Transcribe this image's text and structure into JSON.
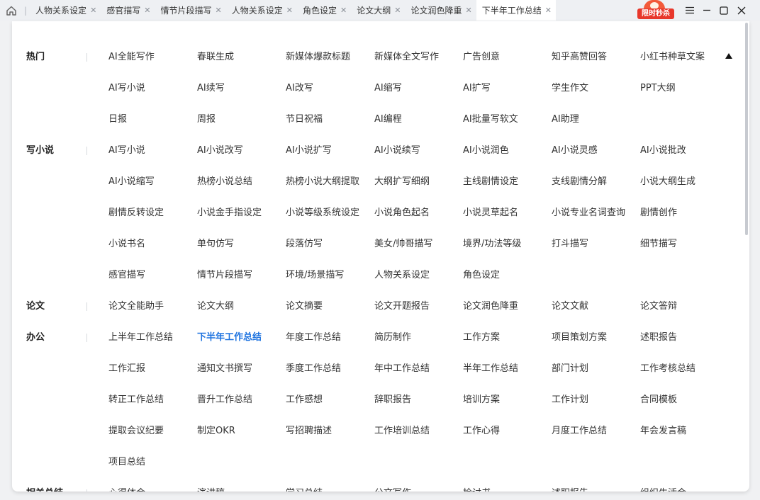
{
  "tabs": [
    {
      "label": "人物关系设定",
      "active": false
    },
    {
      "label": "感官描写",
      "active": false
    },
    {
      "label": "情节片段描写",
      "active": false
    },
    {
      "label": "人物关系设定",
      "active": false
    },
    {
      "label": "角色设定",
      "active": false
    },
    {
      "label": "论文大纲",
      "active": false
    },
    {
      "label": "论文润色降重",
      "active": false
    },
    {
      "label": "下半年工作总结",
      "active": true
    }
  ],
  "promo_label": "限时秒杀",
  "window_controls": [
    "menu-icon",
    "minimize-icon",
    "maximize-icon",
    "close-icon"
  ],
  "accent_color": "#1f74e0",
  "sections": [
    {
      "title": "热门",
      "rows": [
        [
          "AI全能写作",
          "春联生成",
          "新媒体爆款标题",
          "新媒体全文写作",
          "广告创意",
          "知乎高赞回答",
          "小红书种草文案"
        ],
        [
          "AI写小说",
          "AI续写",
          "AI改写",
          "AI缩写",
          "AI扩写",
          "学生作文",
          "PPT大纲"
        ],
        [
          "日报",
          "周报",
          "节日祝福",
          "AI编程",
          "AI批量写软文",
          "AI助理"
        ]
      ]
    },
    {
      "title": "写小说",
      "rows": [
        [
          "AI写小说",
          "AI小说改写",
          "AI小说扩写",
          "AI小说续写",
          "AI小说润色",
          "AI小说灵感",
          "AI小说批改"
        ],
        [
          "AI小说缩写",
          "热榜小说总结",
          "热榜小说大纲提取",
          "大纲扩写细纲",
          "主线剧情设定",
          "支线剧情分解",
          "小说大纲生成"
        ],
        [
          "剧情反转设定",
          "小说金手指设定",
          "小说等级系统设定",
          "小说角色起名",
          "小说灵草起名",
          "小说专业名词查询",
          "剧情创作"
        ],
        [
          "小说书名",
          "单句仿写",
          "段落仿写",
          "美女/帅哥描写",
          "境界/功法等级",
          "打斗描写",
          "细节描写"
        ],
        [
          "感官描写",
          "情节片段描写",
          "环境/场景描写",
          "人物关系设定",
          "角色设定"
        ]
      ]
    },
    {
      "title": "论文",
      "rows": [
        [
          "论文全能助手",
          "论文大纲",
          "论文摘要",
          "论文开题报告",
          "论文润色降重",
          "论文文献",
          "论文答辩"
        ]
      ]
    },
    {
      "title": "办公",
      "rows": [
        [
          "上半年工作总结",
          "下半年工作总结",
          "年度工作总结",
          "简历制作",
          "工作方案",
          "项目策划方案",
          "述职报告"
        ],
        [
          "工作汇报",
          "通知文书撰写",
          "季度工作总结",
          "年中工作总结",
          "半年工作总结",
          "部门计划",
          "工作考核总结"
        ],
        [
          "转正工作总结",
          "晋升工作总结",
          "工作感想",
          "辞职报告",
          "培训方案",
          "工作计划",
          "合同模板"
        ],
        [
          "提取会议纪要",
          "制定OKR",
          "写招聘描述",
          "工作培训总结",
          "工作心得",
          "月度工作总结",
          "年会发言稿"
        ],
        [
          "项目总结"
        ]
      ]
    },
    {
      "title": "相关总结",
      "rows": [
        [
          "心得体会",
          "演讲稿",
          "学习总结",
          "公文写作",
          "检讨书",
          "述职报告",
          "组织生活会"
        ]
      ]
    }
  ],
  "active_item": "下半年工作总结"
}
